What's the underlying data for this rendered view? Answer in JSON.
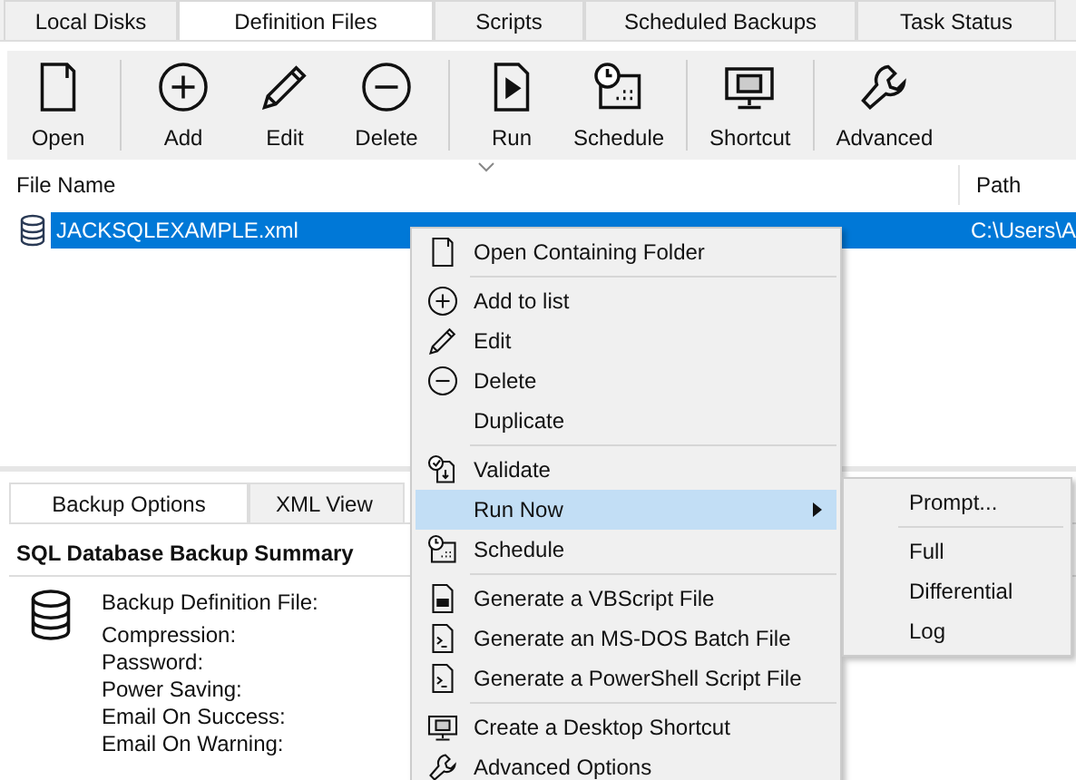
{
  "tabs": [
    {
      "label": "Local Disks",
      "selected": false
    },
    {
      "label": "Definition Files",
      "selected": true
    },
    {
      "label": "Scripts",
      "selected": false
    },
    {
      "label": "Scheduled Backups",
      "selected": false
    },
    {
      "label": "Task Status",
      "selected": false
    }
  ],
  "toolbar": [
    [
      {
        "label": "Open"
      }
    ],
    [
      {
        "label": "Add"
      },
      {
        "label": "Edit"
      },
      {
        "label": "Delete"
      }
    ],
    [
      {
        "label": "Run"
      },
      {
        "label": "Schedule"
      }
    ],
    [
      {
        "label": "Shortcut"
      }
    ],
    [
      {
        "label": "Advanced"
      }
    ]
  ],
  "table": {
    "columns": [
      "File Name",
      "Path"
    ],
    "rows": [
      {
        "file_name": "JACKSQLEXAMPLE.xml",
        "path": "C:\\Users\\A",
        "selected": true
      }
    ]
  },
  "bottom_tabs": [
    {
      "label": "Backup Options",
      "selected": true
    },
    {
      "label": "XML View",
      "selected": false
    }
  ],
  "summary": {
    "title": "SQL Database Backup Summary",
    "fields": [
      "Backup Definition File:",
      "Compression:",
      "Password:",
      "Power Saving:",
      "Email On Success:",
      "Email On Warning:"
    ]
  },
  "context_menu": [
    {
      "kind": "item",
      "label": "Open Containing Folder",
      "selected": false
    },
    {
      "kind": "separator"
    },
    {
      "kind": "item",
      "label": "Add to list",
      "selected": false
    },
    {
      "kind": "item",
      "label": "Edit",
      "selected": false
    },
    {
      "kind": "item",
      "label": "Delete",
      "selected": false
    },
    {
      "kind": "item",
      "label": "Duplicate",
      "selected": false
    },
    {
      "kind": "separator"
    },
    {
      "kind": "item",
      "label": "Validate",
      "selected": false
    },
    {
      "kind": "submenu",
      "label": "Run Now",
      "selected": true
    },
    {
      "kind": "item",
      "label": "Schedule",
      "selected": false
    },
    {
      "kind": "separator"
    },
    {
      "kind": "item",
      "label": "Generate a VBScript File",
      "selected": false
    },
    {
      "kind": "item",
      "label": "Generate an MS-DOS Batch File",
      "selected": false
    },
    {
      "kind": "item",
      "label": "Generate a PowerShell Script File",
      "selected": false
    },
    {
      "kind": "separator"
    },
    {
      "kind": "item",
      "label": "Create a Desktop Shortcut",
      "selected": false
    },
    {
      "kind": "item",
      "label": "Advanced Options",
      "selected": false
    }
  ],
  "submenu": [
    {
      "kind": "item",
      "label": "Prompt..."
    },
    {
      "kind": "separator"
    },
    {
      "kind": "item",
      "label": "Full"
    },
    {
      "kind": "item",
      "label": "Differential"
    },
    {
      "kind": "item",
      "label": "Log"
    }
  ]
}
